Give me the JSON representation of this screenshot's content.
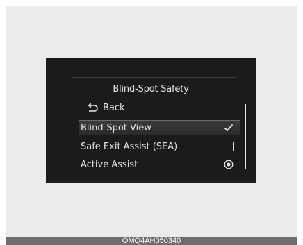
{
  "screen": {
    "title": "Blind-Spot Safety",
    "back_label": "Back",
    "items": [
      {
        "label": "Blind-Spot View",
        "control": "check-icon",
        "selected": true
      },
      {
        "label": "Safe Exit Assist (SEA)",
        "control": "checkbox-icon",
        "selected": false
      },
      {
        "label": "Active Assist",
        "control": "radio-icon",
        "selected": false
      }
    ]
  },
  "footer": {
    "code": "OMQ4AH050340"
  },
  "colors": {
    "screen_bg": "#1b1b1b",
    "frame_bg": "#ebebeb",
    "text": "#e6e6e6",
    "footer_bg": "#6d6d6d"
  }
}
